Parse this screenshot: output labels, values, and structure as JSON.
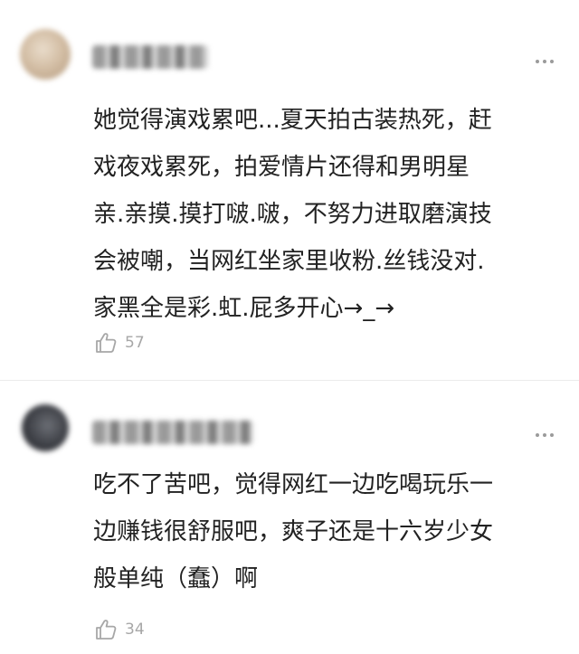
{
  "comments": [
    {
      "body_lines": [
        "她觉得演戏累吧...夏天拍古装热死，赶",
        "戏夜戏累死，拍爱情片还得和男明星",
        "亲.亲摸.摸打啵.啵，不努力进取磨演技",
        "会被嘲，当网红坐家里收粉.丝钱没对.",
        "家黑全是彩.虹.屁多开心→_→"
      ],
      "like_count": "57",
      "like_icon": "thumbs-up-icon",
      "more_icon": "more-dots-icon"
    },
    {
      "body_lines": [
        "吃不了苦吧，觉得网红一边吃喝玩乐一",
        "边赚钱很舒服吧，爽子还是十六岁少女",
        "般单纯（蠢）啊"
      ],
      "like_count": "34",
      "like_icon": "thumbs-up-icon",
      "more_icon": "more-dots-icon"
    }
  ],
  "colors": {
    "text": "#222222",
    "meta": "#a7a7a7",
    "divider": "#ececec"
  }
}
